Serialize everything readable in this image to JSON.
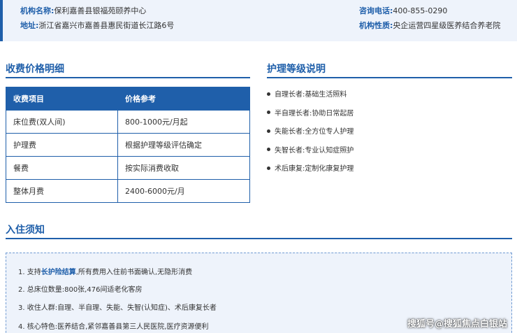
{
  "header": {
    "org_label": "机构名称:",
    "org_value": "保利嘉善县银福苑颐养中心",
    "phone_label": "咨询电话:",
    "phone_value": "400-855-0290",
    "address_label": "地址:",
    "address_value": "浙江省嘉兴市嘉善县惠民街道长江路6号",
    "nature_label": "机构性质:",
    "nature_value": "央企运营四星级医养结合养老院"
  },
  "fees": {
    "title": "收费价格明细",
    "columns": [
      "收费项目",
      "价格参考"
    ],
    "rows": [
      [
        "床位费(双人间)",
        "800-1000元/月起"
      ],
      [
        "护理费",
        "根据护理等级评估确定"
      ],
      [
        "餐费",
        "按实际消费收取"
      ],
      [
        "整体月费",
        "2400-6000元/月"
      ]
    ]
  },
  "care": {
    "title": "护理等级说明",
    "items": [
      "自理长者:基础生活照料",
      "半自理长者:协助日常起居",
      "失能长者:全方位专人护理",
      "失智长者:专业认知症照护",
      "术后康复:定制化康复护理"
    ]
  },
  "notice": {
    "title": "入住须知",
    "item1_prefix": "1. 支持",
    "item1_highlight": "长护险结算",
    "item1_suffix": ",所有费用入住前书面确认,无隐形消费",
    "item2": "2. 总床位数量:800张,476间适老化客房",
    "item3": "3. 收住人群:自理、半自理、失能、失智(认知症)、术后康复长者",
    "item4": "4. 核心特色:医养结合,紧邻嘉善县第三人民医院,医疗资源便利"
  },
  "watermark": "搜狐号@搜狐焦点白银站",
  "colors": {
    "accent": "#1f5faa",
    "panel": "#eef3fb"
  }
}
